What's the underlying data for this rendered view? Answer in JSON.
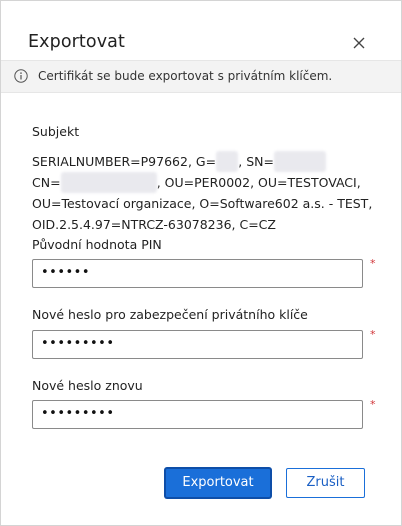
{
  "dialog": {
    "title": "Exportovat",
    "close_icon": "close-icon"
  },
  "info": {
    "icon": "info-icon",
    "text": "Certifikát se bude exportovat s privátním klíčem."
  },
  "subject": {
    "label": "Subjekt",
    "line1_prefix": "SERIALNUMBER=P97662, G=",
    "line1_mid": ", SN=",
    "line2_prefix": "CN=",
    "line2_suffix": ", OU=PER0002, OU=TESTOVACI,",
    "line3": "OU=Testovací organizace, O=Software602 a.s. - TEST,",
    "line4": "OID.2.5.4.97=NTRCZ-63078236, C=CZ"
  },
  "fields": {
    "pin": {
      "label": "Původní hodnota PIN",
      "value": "••••••",
      "required_mark": "*"
    },
    "new_password": {
      "label": "Nové heslo pro zabezpečení privátního klíče",
      "value": "•••••••••",
      "required_mark": "*"
    },
    "repeat_password": {
      "label": "Nové heslo znovu",
      "value": "•••••••••",
      "required_mark": "*"
    }
  },
  "buttons": {
    "export_label": "Exportovat",
    "cancel_label": "Zrušit"
  }
}
